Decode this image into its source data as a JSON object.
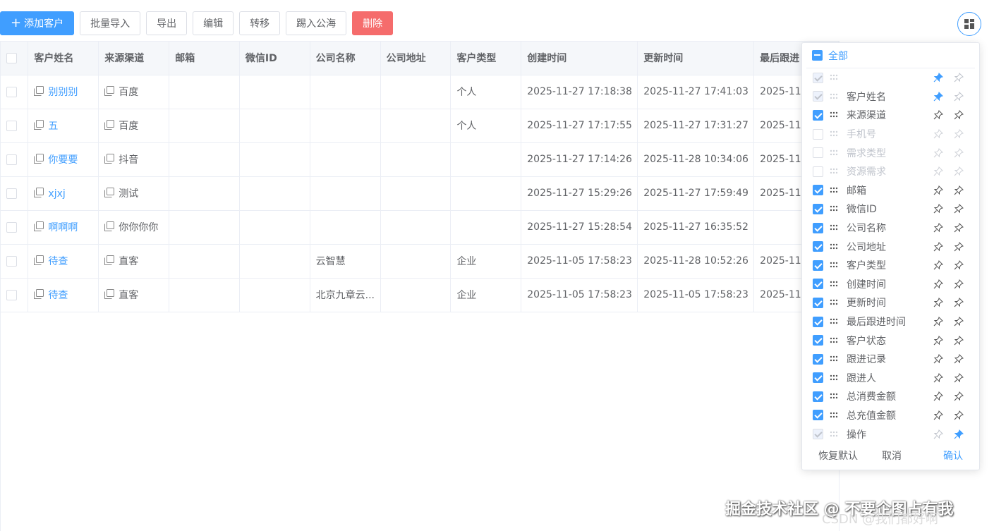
{
  "toolbar": {
    "add": "添加客户",
    "import": "批量导入",
    "export": "导出",
    "edit": "编辑",
    "transfer": "转移",
    "to_pool": "踢入公海",
    "delete": "删除"
  },
  "table": {
    "headers": [
      "客户姓名",
      "来源渠道",
      "邮箱",
      "微信ID",
      "公司名称",
      "公司地址",
      "客户类型",
      "创建时间",
      "更新时间",
      "最后跟进"
    ],
    "rows": [
      {
        "name": "别别别",
        "source": "百度",
        "email": "",
        "wechat": "",
        "company": "",
        "address": "",
        "type": "个人",
        "created": "2025-11-27 17:18:38",
        "updated": "2025-11-27 17:41:03",
        "last": "2025-11"
      },
      {
        "name": "五",
        "source": "百度",
        "email": "",
        "wechat": "",
        "company": "",
        "address": "",
        "type": "个人",
        "created": "2025-11-27 17:17:55",
        "updated": "2025-11-27 17:31:27",
        "last": "2025-11"
      },
      {
        "name": "你要要",
        "source": "抖音",
        "email": "",
        "wechat": "",
        "company": "",
        "address": "",
        "type": "",
        "created": "2025-11-27 17:14:26",
        "updated": "2025-11-28 10:34:06",
        "last": "2025-11"
      },
      {
        "name": "xjxj",
        "source": "测试",
        "email": "",
        "wechat": "",
        "company": "",
        "address": "",
        "type": "",
        "created": "2025-11-27 15:29:26",
        "updated": "2025-11-27 17:59:49",
        "last": "2025-11"
      },
      {
        "name": "啊啊啊",
        "source": "你你你你",
        "email": "",
        "wechat": "",
        "company": "",
        "address": "",
        "type": "",
        "created": "2025-11-27 15:28:54",
        "updated": "2025-11-27 16:35:52",
        "last": ""
      },
      {
        "name": "待查",
        "source": "直客",
        "email": "",
        "wechat": "",
        "company": "云智慧",
        "address": "",
        "type": "企业",
        "created": "2025-11-05 17:58:23",
        "updated": "2025-11-28 10:52:26",
        "last": "2025-11"
      },
      {
        "name": "待查",
        "source": "直客",
        "email": "",
        "wechat": "",
        "company": "北京九章云...",
        "address": "",
        "type": "企业",
        "created": "2025-11-05 17:58:23",
        "updated": "2025-11-05 17:58:23",
        "last": "2025-11"
      }
    ]
  },
  "column_panel": {
    "all_label": "全部",
    "items": [
      {
        "label": "",
        "state": "disabled",
        "pin_left": true,
        "pin_right": false
      },
      {
        "label": "客户姓名",
        "state": "disabled",
        "pin_left": true,
        "pin_right": false
      },
      {
        "label": "来源渠道",
        "state": "checked",
        "pin_left": false,
        "pin_right": false
      },
      {
        "label": "手机号",
        "state": "unchecked",
        "pin_left": false,
        "pin_right": false
      },
      {
        "label": "需求类型",
        "state": "unchecked",
        "pin_left": false,
        "pin_right": false
      },
      {
        "label": "资源需求",
        "state": "unchecked",
        "pin_left": false,
        "pin_right": false
      },
      {
        "label": "邮箱",
        "state": "checked",
        "pin_left": false,
        "pin_right": false
      },
      {
        "label": "微信ID",
        "state": "checked",
        "pin_left": false,
        "pin_right": false
      },
      {
        "label": "公司名称",
        "state": "checked",
        "pin_left": false,
        "pin_right": false
      },
      {
        "label": "公司地址",
        "state": "checked",
        "pin_left": false,
        "pin_right": false
      },
      {
        "label": "客户类型",
        "state": "checked",
        "pin_left": false,
        "pin_right": false
      },
      {
        "label": "创建时间",
        "state": "checked",
        "pin_left": false,
        "pin_right": false
      },
      {
        "label": "更新时间",
        "state": "checked",
        "pin_left": false,
        "pin_right": false
      },
      {
        "label": "最后跟进时间",
        "state": "checked",
        "pin_left": false,
        "pin_right": false
      },
      {
        "label": "客户状态",
        "state": "checked",
        "pin_left": false,
        "pin_right": false
      },
      {
        "label": "跟进记录",
        "state": "checked",
        "pin_left": false,
        "pin_right": false
      },
      {
        "label": "跟进人",
        "state": "checked",
        "pin_left": false,
        "pin_right": false
      },
      {
        "label": "总消费金额",
        "state": "checked",
        "pin_left": false,
        "pin_right": false
      },
      {
        "label": "总充值金额",
        "state": "checked",
        "pin_left": false,
        "pin_right": false
      },
      {
        "label": "操作",
        "state": "disabled",
        "pin_left": false,
        "pin_right": true
      }
    ],
    "reset": "恢复默认",
    "cancel": "取消",
    "confirm": "确认"
  },
  "watermark": {
    "line1": "掘金技术社区 @ 不要企图占有我",
    "line2": "CSDN @我们都好啊"
  },
  "colors": {
    "primary": "#409eff",
    "danger": "#f56c6c",
    "border": "#ebeef5",
    "header_bg": "#f5f7fa"
  }
}
